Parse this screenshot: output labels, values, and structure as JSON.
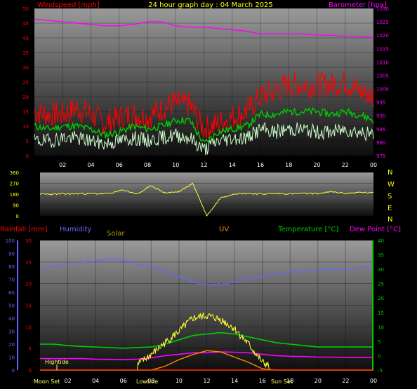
{
  "header": {
    "left": "Windspeed [mph]",
    "center": "24 hour graph day : 04 March 2025",
    "right": "Barometer [hpa]"
  },
  "compass": [
    "N",
    "W",
    "S",
    "E",
    "N"
  ],
  "lower_labels": {
    "rain": "Rainfall [mm]",
    "humidity": "Humidity",
    "solar": "Solar",
    "uv": "UV",
    "temp": "Temperature [°C]",
    "dew": "Dew Point [°C]"
  },
  "annotations": {
    "hightide": "Hightide",
    "moonset": "Moon Set",
    "lowtide": "Lowtide",
    "sunset": "Sun Set"
  },
  "colors": {
    "wind_avg": "#00cc00",
    "wind_gust": "#ff0000",
    "wind_low": "#ccffcc",
    "barometer": "#ff00ff",
    "direction": "#ffff33",
    "humidity": "#6666ff",
    "temperature": "#00cc00",
    "dewpoint": "#ff00ff",
    "solar": "#ffff33",
    "uv": "#ff8800",
    "rain": "#ff3300"
  },
  "chart_data": [
    {
      "type": "line",
      "title": "24 hour graph day : 04 March 2025",
      "ylabel": "Windspeed [mph]",
      "y2label": "Barometer [hpa]",
      "x_ticks": [
        "02",
        "04",
        "06",
        "08",
        "10",
        "12",
        "14",
        "16",
        "18",
        "20",
        "22",
        "00"
      ],
      "y_ticks": [
        0,
        5,
        10,
        15,
        20,
        25,
        30,
        35,
        40,
        45,
        50
      ],
      "y2_ticks": [
        975,
        980,
        985,
        990,
        995,
        1000,
        1005,
        1010,
        1015,
        1020,
        1025,
        1030
      ],
      "ylim": [
        0,
        50
      ],
      "y2lim": [
        975,
        1030
      ],
      "x": [
        0,
        1,
        2,
        3,
        4,
        5,
        6,
        7,
        8,
        9,
        10,
        11,
        12,
        13,
        14,
        15,
        16,
        17,
        18,
        19,
        20,
        21,
        22,
        23,
        24
      ],
      "series": [
        {
          "values": [
            15,
            14,
            14,
            16,
            14,
            11,
            13,
            14,
            13,
            16,
            18,
            17,
            9,
            11,
            13,
            15,
            20,
            22,
            24,
            24,
            24,
            24,
            25,
            22,
            20
          ]
        },
        {
          "values": [
            10,
            9,
            10,
            10,
            9,
            7,
            8,
            10,
            9,
            10,
            12,
            12,
            4,
            8,
            9,
            10,
            14,
            14,
            15,
            15,
            15,
            14,
            15,
            14,
            12
          ]
        },
        {
          "values": [
            5,
            5,
            6,
            6,
            5,
            4,
            5,
            6,
            5,
            6,
            7,
            6,
            2,
            5,
            6,
            6,
            9,
            8,
            9,
            9,
            8,
            8,
            9,
            8,
            7
          ]
        },
        {
          "values": [
            1026,
            1025.5,
            1025,
            1024.5,
            1024,
            1023.5,
            1023.5,
            1024,
            1025,
            1025,
            1023.5,
            1023,
            1023,
            1022.5,
            1022,
            1021.5,
            1020.5,
            1020.5,
            1020.5,
            1020.5,
            1020,
            1020,
            1019.5,
            1019.5,
            1019
          ]
        }
      ]
    },
    {
      "type": "line",
      "y_ticks": [
        0,
        90,
        180,
        270,
        360
      ],
      "ylim": [
        0,
        360
      ],
      "x": [
        0,
        1,
        2,
        3,
        4,
        5,
        6,
        7,
        8,
        9,
        10,
        11,
        11.5,
        12,
        13,
        14,
        15,
        16,
        17,
        18,
        19,
        20,
        21,
        22,
        23,
        24
      ],
      "series": [
        {
          "values": [
            180,
            180,
            182,
            185,
            183,
            185,
            215,
            180,
            250,
            190,
            200,
            270,
            0,
            150,
            185,
            185,
            182,
            185,
            183,
            185,
            185,
            200,
            185,
            195,
            190,
            195
          ]
        }
      ]
    },
    {
      "type": "line",
      "y_ticks": [
        0,
        5,
        10,
        15,
        20,
        25,
        30
      ],
      "y_ticks_left_outer": [
        0,
        10,
        20,
        30,
        40,
        50,
        60,
        70,
        80,
        90,
        100
      ],
      "y2_ticks": [
        -5,
        0,
        5,
        10,
        15,
        20,
        25,
        30,
        35,
        40
      ],
      "ylim": [
        0,
        30
      ],
      "y2lim": [
        -5,
        40
      ],
      "x_ticks": [
        "02",
        "04",
        "06",
        "08",
        "10",
        "12",
        "14",
        "16",
        "18",
        "20",
        "22",
        "00"
      ],
      "x": [
        0,
        1,
        2,
        3,
        4,
        5,
        6,
        7,
        8,
        9,
        10,
        11,
        12,
        13,
        14,
        15,
        16,
        17,
        18,
        19,
        20,
        21,
        22,
        23,
        24
      ],
      "series": [
        {
          "values": [
            78,
            80,
            82,
            83,
            84,
            86,
            85,
            82,
            80,
            76,
            72,
            68,
            66,
            66,
            68,
            70,
            72,
            74,
            76,
            76,
            77,
            78,
            78,
            79,
            79
          ]
        },
        {
          "values": [
            4,
            4,
            3.5,
            3.2,
            3,
            2.8,
            2.6,
            2.8,
            3,
            4,
            5.5,
            7,
            7.5,
            8,
            7.5,
            6.5,
            5.5,
            4.5,
            4,
            3.5,
            3,
            3,
            3,
            3,
            3
          ]
        },
        {
          "values": [
            -1,
            -1,
            -1,
            -1,
            -1.2,
            -1.3,
            -1.4,
            -1.2,
            -0.8,
            0,
            0.5,
            1,
            1,
            1.3,
            1.2,
            1,
            0.5,
            0,
            -0.2,
            -0.3,
            -0.5,
            -0.5,
            -0.6,
            -0.6,
            -0.6
          ]
        },
        {
          "values": [
            0,
            0,
            0,
            0,
            0,
            0,
            0,
            40,
            120,
            210,
            300,
            400,
            420,
            390,
            320,
            200,
            60,
            0,
            0,
            0,
            0,
            0,
            0,
            0,
            0
          ]
        },
        {
          "values": [
            0,
            0,
            0,
            0,
            0,
            0,
            0,
            0,
            0,
            0.3,
            0.8,
            1.2,
            1.5,
            1.4,
            1.0,
            0.6,
            0.1,
            0,
            0,
            0,
            0,
            0,
            0,
            0,
            0
          ]
        },
        {
          "values": [
            0,
            0,
            0,
            0,
            0,
            0,
            0,
            0,
            0,
            0,
            0,
            0,
            0,
            0,
            0,
            0,
            0,
            0,
            0,
            0,
            0,
            0,
            0,
            0,
            0
          ]
        }
      ]
    }
  ]
}
